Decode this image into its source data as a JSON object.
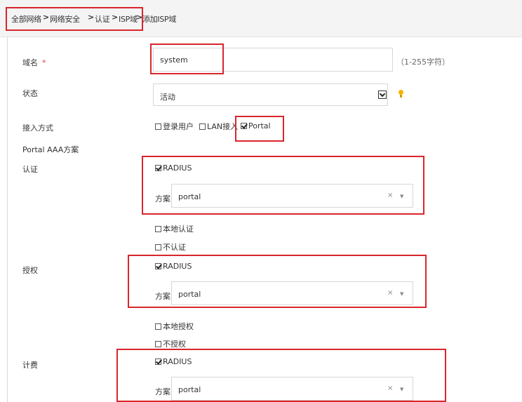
{
  "breadcrumb": {
    "items": [
      "全部网络",
      "网络安全",
      "认证",
      "ISP域",
      "添加ISP域"
    ],
    "separator": ">"
  },
  "form": {
    "domain_name": {
      "label": "域名",
      "required_mark": "*",
      "value": "system",
      "hint": "（1-255字符）"
    },
    "status": {
      "label": "状态",
      "value": "活动"
    },
    "access_mode": {
      "label": "接入方式",
      "options": [
        {
          "label": "登录用户",
          "checked": false
        },
        {
          "label": "LAN接入",
          "checked": false
        },
        {
          "label": "Portal",
          "checked": true
        }
      ]
    },
    "aaa_section_label": "Portal AAA方案",
    "authentication": {
      "label": "认证",
      "radius_label": "RADIUS",
      "radius_checked": true,
      "scheme_label": "方案",
      "scheme_value": "portal",
      "local_label": "本地认证",
      "none_label": "不认证"
    },
    "authorization": {
      "label": "授权",
      "radius_label": "RADIUS",
      "radius_checked": true,
      "scheme_label": "方案",
      "scheme_value": "portal",
      "local_label": "本地授权",
      "none_label": "不授权"
    },
    "accounting": {
      "label": "计费",
      "radius_label": "RADIUS",
      "radius_checked": true,
      "scheme_label": "方案",
      "scheme_value": "portal"
    }
  },
  "icons": {
    "clear": "×",
    "dropdown": "▼"
  },
  "colors": {
    "highlight_box": "#d9262c",
    "required": "#e33b3b",
    "tip_icon": "#f5b400"
  }
}
